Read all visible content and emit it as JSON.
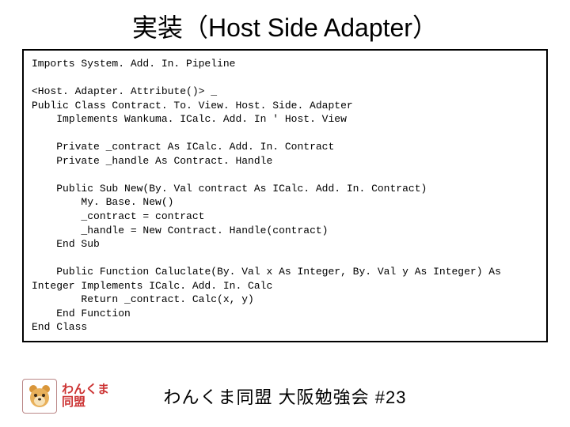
{
  "title": "実装（Host Side Adapter）",
  "code": "Imports System. Add. In. Pipeline\n\n<Host. Adapter. Attribute()> _\nPublic Class Contract. To. View. Host. Side. Adapter\n    Implements Wankuma. ICalc. Add. In ' Host. View\n\n    Private _contract As ICalc. Add. In. Contract\n    Private _handle As Contract. Handle\n\n    Public Sub New(By. Val contract As ICalc. Add. In. Contract)\n        My. Base. New()\n        _contract = contract\n        _handle = New Contract. Handle(contract)\n    End Sub\n\n    Public Function Caluclate(By. Val x As Integer, By. Val y As Integer) As Integer Implements ICalc. Add. In. Calc\n        Return _contract. Calc(x, y)\n    End Function\nEnd Class",
  "logo": {
    "line1": "わんくま",
    "line2": "同盟"
  },
  "footer": "わんくま同盟 大阪勉強会 #23"
}
